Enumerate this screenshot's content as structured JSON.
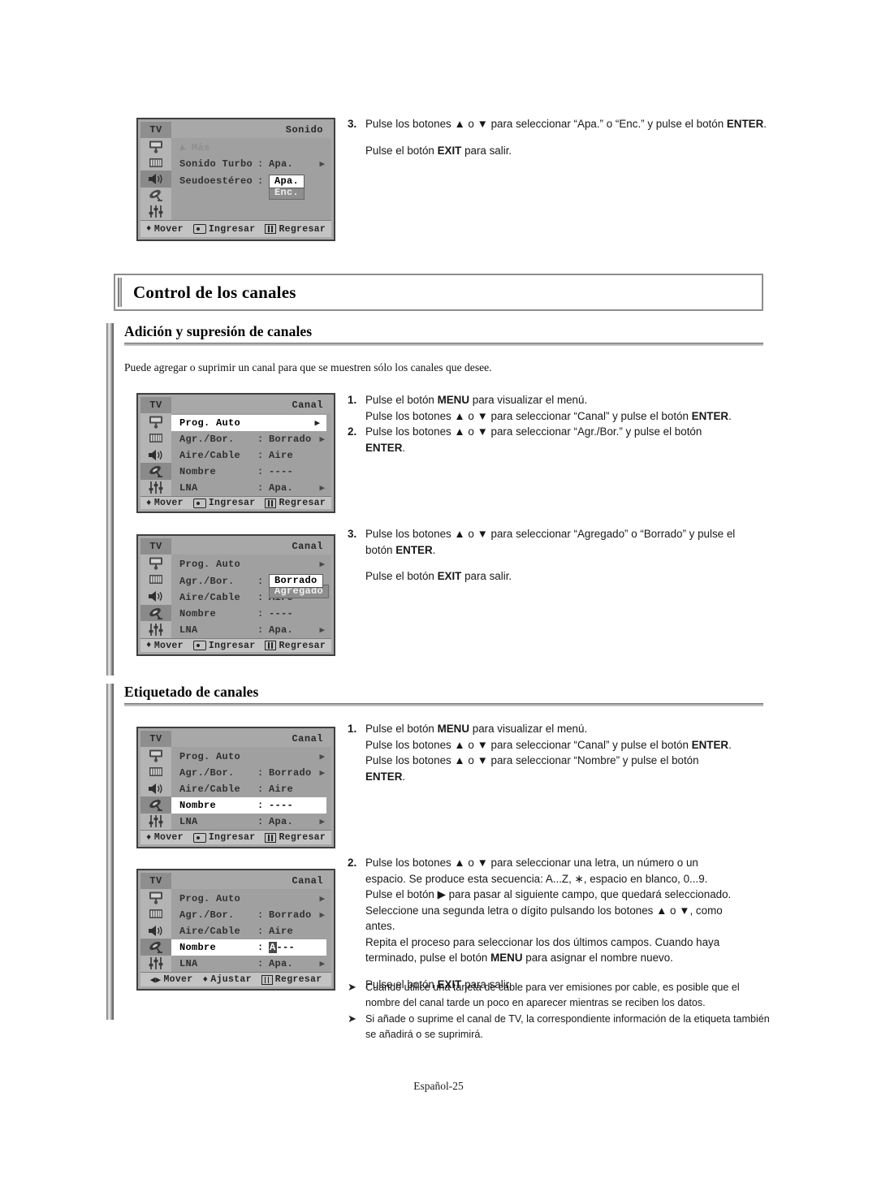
{
  "page": {
    "footer": "Español-25",
    "section_title": "Control de los canales",
    "subsections": [
      {
        "heading": "Adición y supresión de canales",
        "intro": "Puede agregar o suprimir un canal para que se muestren sólo los canales que desee."
      },
      {
        "heading": "Etiquetado de canales"
      }
    ]
  },
  "osd_common": {
    "tv_label": "TV",
    "icons": [
      "picture-icon",
      "channel-icon",
      "sound-icon",
      "setup-icon",
      "equalizer-icon"
    ],
    "foot_move": "Mover",
    "foot_enter": "Ingresar",
    "foot_return": "Regresar",
    "foot_adjust": "Ajustar",
    "arrow_right": "▶",
    "arrow_updown": "♦",
    "arrow_leftright": "◀▶"
  },
  "osd_sound": {
    "header": "Sonido",
    "selected_icon": 2,
    "rows": [
      {
        "label": "▲ Más",
        "colon": "",
        "value": "",
        "arrow": false,
        "dim": true
      },
      {
        "label": "Sonido Turbo",
        "colon": ":",
        "value": "Apa.",
        "arrow": true
      },
      {
        "label": "Seudoestéreo",
        "colon": ":",
        "value": "Apa.",
        "alt_value": "Enc.",
        "arrow": false,
        "boxed": true
      }
    ]
  },
  "osd_canal_1": {
    "header": "Canal",
    "selected_icon": 3,
    "rows": [
      {
        "label": "Prog. Auto",
        "colon": "",
        "value": "",
        "arrow": true,
        "highlight": true
      },
      {
        "label": "Agr./Bor.",
        "colon": ":",
        "value": "Borrado",
        "arrow": true
      },
      {
        "label": "Aire/Cable",
        "colon": ":",
        "value": "Aire",
        "arrow": false
      },
      {
        "label": "Nombre",
        "colon": ":",
        "value": "----",
        "arrow": false
      },
      {
        "label": "LNA",
        "colon": ":",
        "value": "Apa.",
        "arrow": true
      }
    ]
  },
  "osd_canal_2": {
    "header": "Canal",
    "selected_icon": 3,
    "rows": [
      {
        "label": "Prog. Auto",
        "colon": "",
        "value": "",
        "arrow": true
      },
      {
        "label": "Agr./Bor.",
        "colon": ":",
        "value": "Borrado",
        "alt_value": "Agregado",
        "arrow": false,
        "boxed": true
      },
      {
        "label": "Aire/Cable",
        "colon": ":",
        "value": "Aire",
        "arrow": false
      },
      {
        "label": "Nombre",
        "colon": ":",
        "value": "----",
        "arrow": false
      },
      {
        "label": "LNA",
        "colon": ":",
        "value": "Apa.",
        "arrow": true
      }
    ]
  },
  "osd_canal_3": {
    "header": "Canal",
    "selected_icon": 3,
    "rows": [
      {
        "label": "Prog. Auto",
        "colon": "",
        "value": "",
        "arrow": true
      },
      {
        "label": "Agr./Bor.",
        "colon": ":",
        "value": "Borrado",
        "arrow": true
      },
      {
        "label": "Aire/Cable",
        "colon": ":",
        "value": "Aire",
        "arrow": false
      },
      {
        "label": "Nombre",
        "colon": ":",
        "value": "----",
        "arrow": false,
        "highlight": true
      },
      {
        "label": "LNA",
        "colon": ":",
        "value": "Apa.",
        "arrow": true
      }
    ]
  },
  "osd_canal_4": {
    "header": "Canal",
    "selected_icon": 3,
    "rows": [
      {
        "label": "Prog. Auto",
        "colon": "",
        "value": "",
        "arrow": true
      },
      {
        "label": "Agr./Bor.",
        "colon": ":",
        "value": "Borrado",
        "arrow": true
      },
      {
        "label": "Aire/Cable",
        "colon": ":",
        "value": "Aire",
        "arrow": false
      },
      {
        "label": "Nombre",
        "colon": ":",
        "value_sel": "A",
        "value_rest": "---",
        "arrow": false,
        "highlight": true
      },
      {
        "label": "LNA",
        "colon": ":",
        "value": "Apa.",
        "arrow": true
      }
    ]
  },
  "instructions": {
    "sound_step3": {
      "num": "3.",
      "line1_a": "Pulse los botones ",
      "line1_up": "▲",
      "line1_b": " o ",
      "line1_dn": "▼",
      "line1_c": " para seleccionar “Apa.” o “Enc.”  y pulse el botón ",
      "line1_bold": "ENTER",
      "line1_d": ".",
      "exit_a": "Pulse el botón ",
      "exit_bold": "EXIT",
      "exit_b": " para salir."
    },
    "add_step1": {
      "num": "1.",
      "l1_a": "Pulse el botón ",
      "l1_bold": "MENU",
      "l1_b": " para visualizar el menú.",
      "l2_a": "Pulse los botones ▲ o ▼ para seleccionar “Canal” y pulse el botón ",
      "l2_bold": "ENTER",
      "l2_b": "."
    },
    "add_step2": {
      "num": "2.",
      "l1": "Pulse los botones ▲ o ▼ para seleccionar “Agr./Bor.” y pulse el botón",
      "l2_bold": "ENTER",
      "l2_b": "."
    },
    "add_step3": {
      "num": "3.",
      "l1": "Pulse los botones ▲ o ▼ para seleccionar “Agregado” o “Borrado” y pulse el",
      "l2_a": "botón ",
      "l2_bold": "ENTER",
      "l2_b": ".",
      "exit_a": "Pulse el botón ",
      "exit_bold": "EXIT",
      "exit_b": " para salir."
    },
    "label_step1": {
      "num": "1.",
      "l1_a": "Pulse el botón ",
      "l1_bold": "MENU",
      "l1_b": " para visualizar el menú.",
      "l2_a": "Pulse los botones ▲ o ▼ para seleccionar “Canal” y pulse el botón ",
      "l2_bold": "ENTER",
      "l2_b": ".",
      "l3": "Pulse los botones ▲ o ▼ para seleccionar “Nombre” y pulse el botón",
      "l4_bold": "ENTER",
      "l4_b": "."
    },
    "label_step2": {
      "num": "2.",
      "l1": "Pulse los botones ▲ o ▼ para seleccionar una letra, un número o un",
      "l2": "espacio. Se produce esta secuencia: A...Z, ∗, espacio en blanco, 0...9.",
      "l3": "Pulse el botón ▶ para pasar al siguiente campo, que quedará seleccionado.",
      "l4": "Seleccione una segunda letra o dígito pulsando los botones ▲ o ▼, como",
      "l5": "antes.",
      "l6": "Repita el proceso para seleccionar los dos últimos campos. Cuando haya",
      "l7_a": "terminado, pulse el botón ",
      "l7_bold": "MENU",
      "l7_b": " para asignar el nombre nuevo.",
      "exit_a": "Pulse el botón ",
      "exit_bold": "EXIT",
      "exit_b": " para salir."
    },
    "notes": [
      "Cuando utilice una tarjeta de cable para ver emisiones por cable, es posible que el nombre del canal tarde un poco en aparecer mientras se reciben los datos.",
      "Si añade o suprime el canal de TV, la correspondiente información de la etiqueta también se añadirá o se suprimirá."
    ],
    "note_bullet_icon": "arrow-bullet-icon"
  }
}
